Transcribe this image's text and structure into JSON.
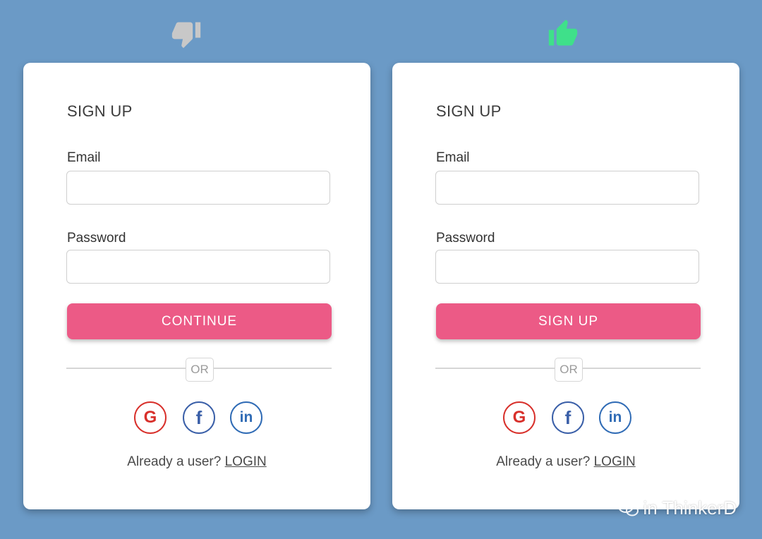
{
  "colors": {
    "background": "#6b9ac6",
    "card": "#ffffff",
    "primary_button": "#ec5a86",
    "thumbs_down": "#c8c8c8",
    "thumbs_up": "#3fe08a",
    "google": "#d8302b",
    "facebook": "#3a5fa8",
    "linkedin": "#2f6bb5"
  },
  "indicators": {
    "left": "thumbs-down-icon",
    "right": "thumbs-up-icon"
  },
  "left_card": {
    "title": "SIGN UP",
    "email_label": "Email",
    "email_value": "",
    "password_label": "Password",
    "password_value": "",
    "primary_button": "CONTINUE",
    "divider_text": "OR",
    "social": [
      {
        "icon": "google-icon",
        "glyph": "G"
      },
      {
        "icon": "facebook-icon",
        "glyph": "f"
      },
      {
        "icon": "linkedin-icon",
        "glyph": "in"
      }
    ],
    "footer_text": "Already a user?",
    "footer_link": "LOGIN"
  },
  "right_card": {
    "title": "SIGN UP",
    "email_label": "Email",
    "email_value": "",
    "password_label": "Password",
    "password_value": "",
    "primary_button": "SIGN UP",
    "divider_text": "OR",
    "social": [
      {
        "icon": "google-icon",
        "glyph": "G"
      },
      {
        "icon": "facebook-icon",
        "glyph": "f"
      },
      {
        "icon": "linkedin-icon",
        "glyph": "in"
      }
    ],
    "footer_text": "Already a user?",
    "footer_link": "LOGIN"
  },
  "watermark": "in ThinkerD"
}
